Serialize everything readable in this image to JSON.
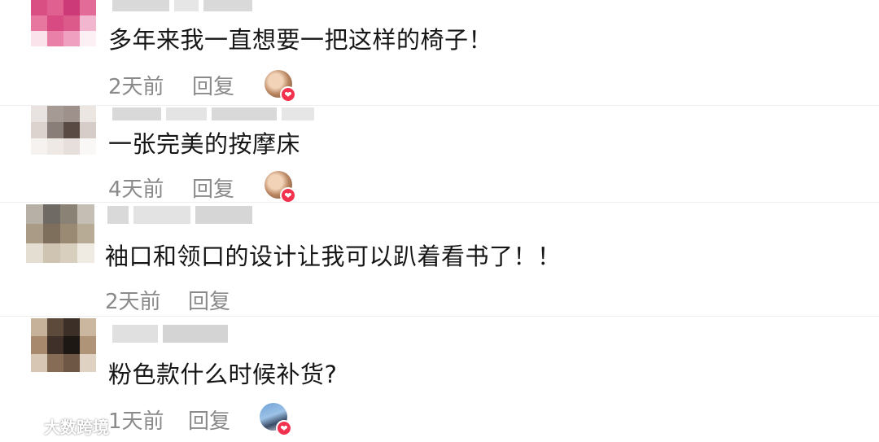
{
  "comments": [
    {
      "text": "多年来我一直想要一把这样的椅子！",
      "time": "2天前",
      "reply": "回复",
      "has_author_like": true
    },
    {
      "text": "一张完美的按摩床",
      "time": "4天前",
      "reply": "回复",
      "has_author_like": true
    },
    {
      "text": "袖口和领口的设计让我可以趴着看书了！！",
      "time": "2天前",
      "reply": "回复",
      "has_author_like": false
    },
    {
      "text": "粉色款什么时候补货?",
      "time": "1天前",
      "reply": "回复",
      "has_author_like": true
    }
  ],
  "icons": {
    "liked_by_author": "heart-icon",
    "avatar": "pixelated-avatar",
    "watermark": "weibo-logo-icon"
  },
  "watermark": {
    "text": "大数跨境"
  },
  "colors": {
    "heart": "#f2314f",
    "meta_text": "#8a8a8a",
    "main_text": "#161616",
    "separator": "#eeeeee"
  }
}
